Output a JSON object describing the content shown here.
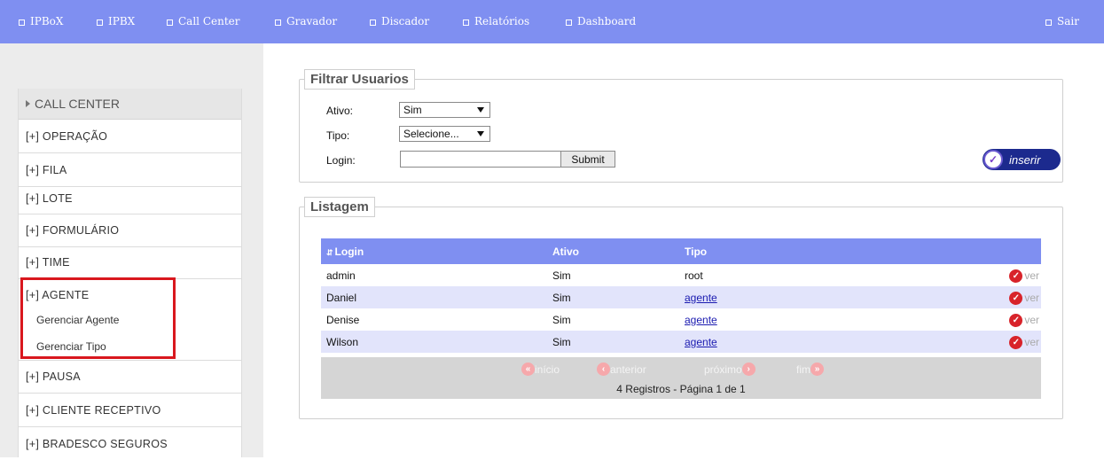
{
  "topnav": {
    "items": [
      {
        "label": "IPBoX"
      },
      {
        "label": "IPBX"
      },
      {
        "label": "Call Center"
      },
      {
        "label": "Gravador"
      },
      {
        "label": "Discador"
      },
      {
        "label": "Relatórios"
      },
      {
        "label": "Dashboard"
      }
    ],
    "logout": "Sair"
  },
  "sidebar": {
    "header": "CALL CENTER",
    "items": [
      {
        "label": "[+] OPERAÇÃO"
      },
      {
        "label": "[+] FILA"
      },
      {
        "label": "[+] LOTE"
      },
      {
        "label": "[+] FORMULÁRIO"
      },
      {
        "label": "[+] TIME"
      },
      {
        "label": "[+] AGENTE"
      },
      {
        "label": "[+] PAUSA"
      },
      {
        "label": "[+] CLIENTE RECEPTIVO"
      },
      {
        "label": "[+] BRADESCO SEGUROS"
      }
    ],
    "subitems": [
      {
        "label": "Gerenciar Agente"
      },
      {
        "label": "Gerenciar Tipo"
      }
    ],
    "highlight_color": "#d9171e"
  },
  "filter": {
    "legend": "Filtrar Usuarios",
    "ativo_label": "Ativo:",
    "ativo_value": "Sim",
    "tipo_label": "Tipo:",
    "tipo_value": "Selecione...",
    "login_label": "Login:",
    "login_value": "",
    "submit_label": "Submit",
    "inserir_label": "inserir"
  },
  "listing": {
    "legend": "Listagem",
    "sort_icon": "sort-arrows-icon",
    "columns": [
      "Login",
      "Ativo",
      "Tipo"
    ],
    "rows": [
      {
        "login": "admin",
        "ativo": "Sim",
        "tipo": "root",
        "link": false,
        "action": "ver"
      },
      {
        "login": "Daniel",
        "ativo": "Sim",
        "tipo": "agente",
        "link": true,
        "action": "ver"
      },
      {
        "login": "Denise",
        "ativo": "Sim",
        "tipo": "agente",
        "link": true,
        "action": "ver"
      },
      {
        "login": "Wilson",
        "ativo": "Sim",
        "tipo": "agente",
        "link": true,
        "action": "ver"
      }
    ],
    "pager": {
      "first": "início",
      "prev": "anterior",
      "next": "próximo",
      "last": "fim",
      "status": "4 Registros - Página 1 de 1"
    }
  },
  "colors": {
    "accent": "#7f8ff1",
    "row_alt": "#e2e4fb",
    "action_red": "#d8232a"
  }
}
